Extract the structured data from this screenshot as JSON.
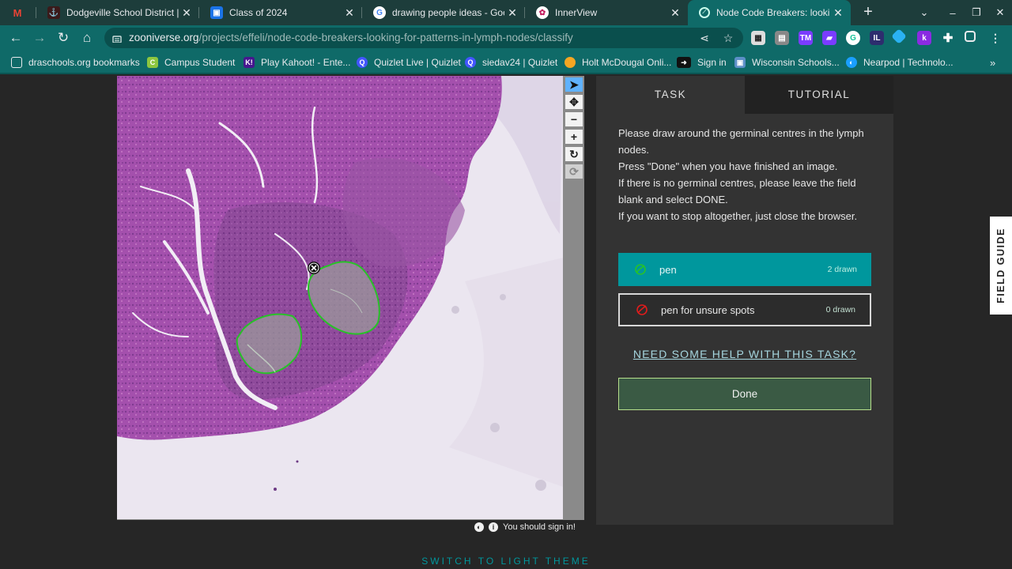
{
  "browser": {
    "tabs": [
      {
        "title": "",
        "icon": "gmail-icon"
      },
      {
        "title": "Dodgeville School District | D",
        "icon": "district-icon"
      },
      {
        "title": "Class of 2024",
        "icon": "classroom-icon"
      },
      {
        "title": "drawing people ideas - Googl",
        "icon": "google-icon"
      },
      {
        "title": "InnerView",
        "icon": "innerview-icon"
      },
      {
        "title": "Node Code Breakers: looking",
        "icon": "zooniverse-icon",
        "active": true
      }
    ],
    "new_tab": "+",
    "url_host": "zooniverse.org",
    "url_path": "/projects/effeli/node-code-breakers-looking-for-patterns-in-lymph-nodes/classify",
    "bookmarks": [
      {
        "label": "draschools.org bookmarks",
        "icon": "folder-icon",
        "color": "#e8eaed"
      },
      {
        "label": "Campus Student",
        "icon": "campus-icon",
        "color": "#8dc63f"
      },
      {
        "label": "Play Kahoot! - Ente...",
        "icon": "kahoot-icon",
        "color": "#46178f"
      },
      {
        "label": "Quizlet Live | Quizlet",
        "icon": "quizlet-icon",
        "color": "#4255ff"
      },
      {
        "label": "siedav24 | Quizlet",
        "icon": "quizlet-icon",
        "color": "#4255ff"
      },
      {
        "label": "Holt McDougal Onli...",
        "icon": "holt-icon",
        "color": "#f5a623"
      },
      {
        "label": "Sign in",
        "icon": "signin-icon",
        "color": "#111111"
      },
      {
        "label": "Wisconsin Schools...",
        "icon": "wisconsin-icon",
        "color": "#5c8fc7"
      },
      {
        "label": "Nearpod | Technolo...",
        "icon": "nearpod-icon",
        "color": "#1a9fff"
      }
    ]
  },
  "task": {
    "tabs": [
      "TASK",
      "TUTORIAL"
    ],
    "instructions": [
      "Please draw around the germinal centres in the lymph nodes.",
      "Press \"Done\" when you have finished an image.",
      "If there is no germinal centres, please leave the field blank and select DONE.",
      "If you want to stop altogether, just close the browser."
    ],
    "tools": [
      {
        "label": "pen",
        "count": "2 drawn",
        "color": "#28c228",
        "selected": true
      },
      {
        "label": "pen for unsure spots",
        "count": "0 drawn",
        "color": "#e01c1c",
        "selected": false
      }
    ],
    "help_link": "NEED SOME HELP WITH THIS TASK?",
    "done": "Done"
  },
  "viewer": {
    "signin_notice": "You should sign in!",
    "controls": [
      "pointer",
      "move",
      "zoom-out",
      "zoom-in",
      "rotate",
      "reset"
    ]
  },
  "field_guide": "FIELD GUIDE",
  "theme_switch": "SWITCH TO LIGHT THEME",
  "colors": {
    "tab_strip": "#1d3d3b",
    "toolbar": "#0f6a68",
    "accent_teal": "#00979d",
    "annotation_green": "#28c228"
  }
}
